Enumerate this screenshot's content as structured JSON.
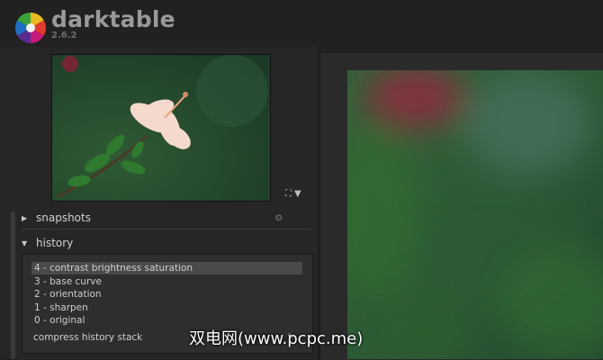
{
  "app": {
    "title": "darktable",
    "version": "2.6.2"
  },
  "navigator": {
    "zoom_icon": "fit-screen-icon",
    "dropdown_icon": "triangle-down-icon"
  },
  "modules": {
    "snapshots": {
      "label": "snapshots",
      "expanded": false,
      "options_icon": "circle-dot-icon"
    },
    "history": {
      "label": "history",
      "expanded": true,
      "items": [
        {
          "label": "4 - contrast brightness saturation",
          "selected": true
        },
        {
          "label": "3 - base curve",
          "selected": false
        },
        {
          "label": "2 - orientation",
          "selected": false
        },
        {
          "label": "1 - sharpen",
          "selected": false
        },
        {
          "label": "0 - original",
          "selected": false
        }
      ],
      "compress_label": "compress history stack",
      "compress_icon": "style-icon"
    }
  },
  "watermark": "双电网(www.pcpc.me)",
  "colors": {
    "background": "#212121",
    "panel": "#262626",
    "selected_row": "#4a4a4a"
  }
}
